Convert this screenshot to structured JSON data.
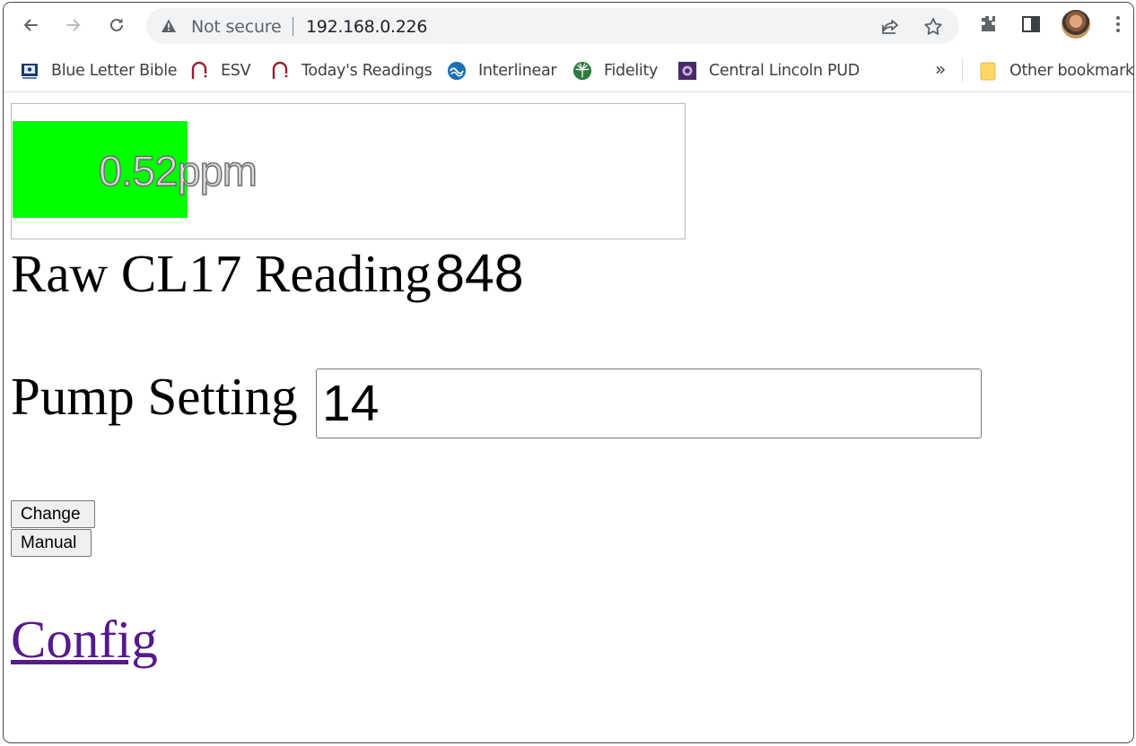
{
  "browser": {
    "security_text": "Not secure",
    "url": "192.168.0.226"
  },
  "bookmarks": [
    {
      "label": "Blue Letter Bible",
      "icon": "book-icon"
    },
    {
      "label": "ESV",
      "icon": "esv-icon"
    },
    {
      "label": "Today's Readings",
      "icon": "esv-icon"
    },
    {
      "label": "Interlinear",
      "icon": "interlinear-icon"
    },
    {
      "label": "Fidelity",
      "icon": "fidelity-icon"
    },
    {
      "label": "Central Lincoln PUD",
      "icon": "pud-icon"
    }
  ],
  "bookmarks_overflow": "»",
  "other_bookmarks": "Other bookmarks",
  "page": {
    "gauge": {
      "text": "0.52ppm",
      "fill_fraction": 0.26,
      "fill_color": "#00ff00"
    },
    "raw_label": "Raw CL17 Reading",
    "raw_value": "848",
    "pump_label": "Pump Setting",
    "pump_value": "14",
    "change_button": "Change",
    "manual_button": "Manual",
    "config_link": "Config"
  }
}
